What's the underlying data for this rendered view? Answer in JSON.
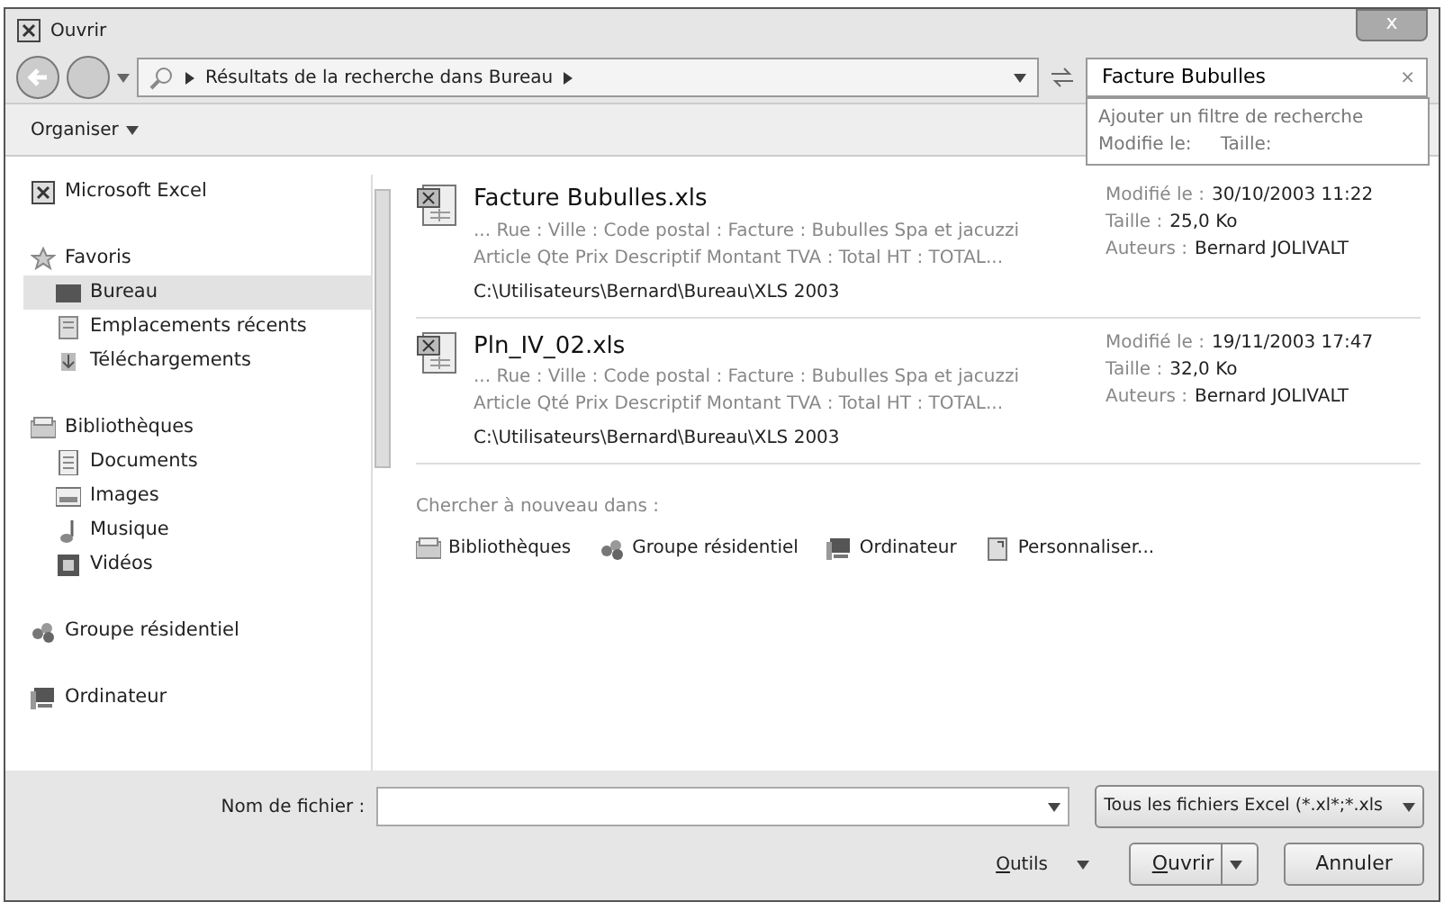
{
  "window": {
    "title": "Ouvrir",
    "close": "x"
  },
  "nav": {
    "path": [
      "Résultats de la recherche dans Bureau"
    ],
    "search": {
      "value": "Facture Bubulles",
      "clear": "×"
    }
  },
  "search_popup": {
    "hint": "Ajouter un filtre de recherche",
    "filters": [
      "Modifie le:",
      "Taille:"
    ]
  },
  "toolbar": {
    "organize": "Organiser"
  },
  "sidebar": {
    "items": [
      {
        "label": "Microsoft Excel",
        "selected": false
      },
      {
        "label": "Favoris",
        "selected": false,
        "children": [
          {
            "label": "Bureau",
            "selected": true
          },
          {
            "label": "Emplacements récents",
            "selected": false
          },
          {
            "label": "Téléchargements",
            "selected": false
          }
        ]
      },
      {
        "label": "Bibliothèques",
        "selected": false,
        "children": [
          {
            "label": "Documents",
            "selected": false
          },
          {
            "label": "Images",
            "selected": false
          },
          {
            "label": "Musique",
            "selected": false
          },
          {
            "label": "Vidéos",
            "selected": false
          }
        ]
      },
      {
        "label": "Groupe résidentiel",
        "selected": false
      },
      {
        "label": "Ordinateur",
        "selected": false
      }
    ]
  },
  "results": [
    {
      "name": "Facture Bubulles.xls",
      "snippet": [
        "... Rue : Ville : Code postal : Facture : Bubulles Spa et jacuzzi",
        "Article Qte Prix Descriptif Montant TVA : Total HT : TOTAL..."
      ],
      "path": "C:\\Utilisateurs\\Bernard\\Bureau\\XLS 2003",
      "meta": [
        {
          "label": "Modifié le :",
          "value": "30/10/2003 11:22"
        },
        {
          "label": "Taille :",
          "value": "25,0 Ko"
        },
        {
          "label": "Auteurs :",
          "value": "Bernard JOLIVALT"
        }
      ]
    },
    {
      "name": "Pln_IV_02.xls",
      "snippet": [
        "... Rue : Ville : Code postal : Facture : Bubulles Spa et jacuzzi",
        "Article Qté Prix Descriptif Montant TVA : Total HT : TOTAL..."
      ],
      "path": "C:\\Utilisateurs\\Bernard\\Bureau\\XLS 2003",
      "meta": [
        {
          "label": "Modifié le :",
          "value": "19/11/2003 17:47"
        },
        {
          "label": "Taille :",
          "value": "32,0 Ko"
        },
        {
          "label": "Auteurs :",
          "value": "Bernard JOLIVALT"
        }
      ]
    }
  ],
  "search_again": {
    "label": "Chercher à nouveau dans :",
    "locations": [
      {
        "label": "Bibliothèques"
      },
      {
        "label": "Groupe résidentiel"
      },
      {
        "label": "Ordinateur"
      },
      {
        "label": "Personnaliser..."
      }
    ]
  },
  "footer": {
    "filename_label": "Nom de fichier :",
    "filetype": "Tous les fichiers Excel (*.xl*;*.xls",
    "tools": "Outils",
    "open": "Ouvrir",
    "cancel": "Annuler"
  }
}
